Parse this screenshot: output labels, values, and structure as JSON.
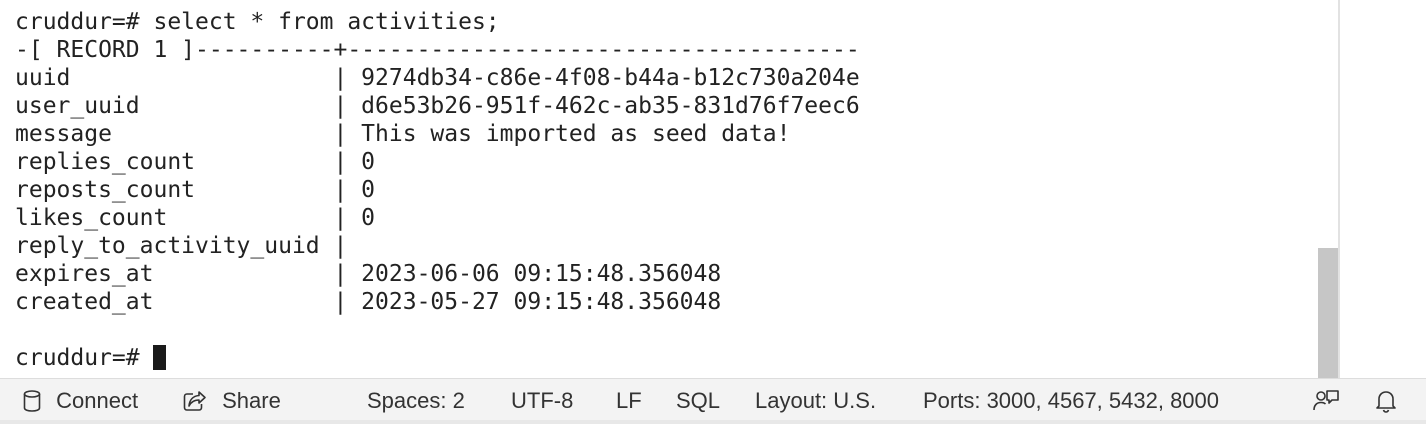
{
  "terminal": {
    "lines": [
      "cruddur=# select * from activities;",
      "-[ RECORD 1 ]----------+-------------------------------------",
      "uuid                   | 9274db34-c86e-4f08-b44a-b12c730a204e",
      "user_uuid              | d6e53b26-951f-462c-ab35-831d76f7eec6",
      "message                | This was imported as seed data!",
      "replies_count          | 0",
      "reposts_count          | 0",
      "likes_count            | 0",
      "reply_to_activity_uuid |",
      "expires_at             | 2023-06-06 09:15:48.356048",
      "created_at             | 2023-05-27 09:15:48.356048",
      ""
    ],
    "prompt": "cruddur=# "
  },
  "statusbar": {
    "connect_label": "Connect",
    "connect_icon": "database-icon",
    "share_label": "Share",
    "share_icon": "share-icon",
    "spaces": "Spaces: 2",
    "encoding": "UTF-8",
    "eol": "LF",
    "language": "SQL",
    "layout": "Layout: U.S.",
    "ports": "Ports: 3000, 4567, 5432, 8000",
    "feedback_icon": "feedback-icon",
    "notifications_icon": "bell-icon"
  }
}
